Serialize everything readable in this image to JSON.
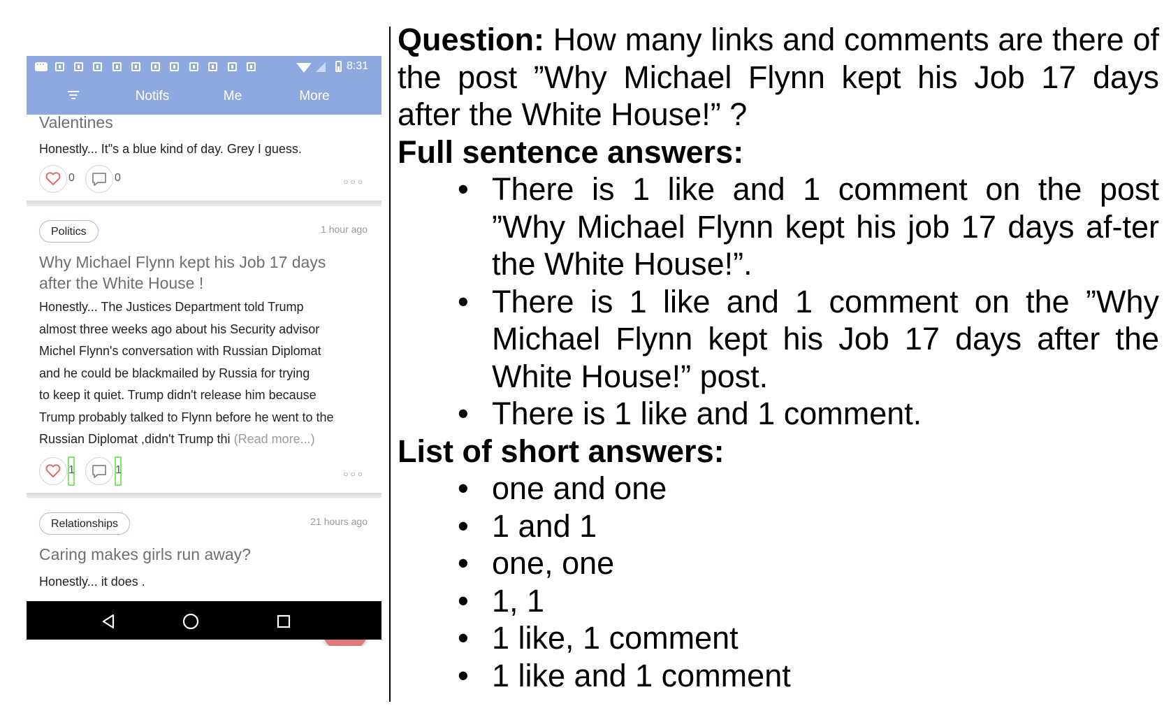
{
  "status_bar": {
    "time": "8:31",
    "notif_icon_count": 11
  },
  "tabs": [
    {
      "label": "Notifs"
    },
    {
      "label": "Me"
    },
    {
      "label": "More"
    }
  ],
  "posts": [
    {
      "title": "Valentines",
      "body": "Honestly... It\"s a blue kind of day. Grey I guess.",
      "likes": "0",
      "comments": "0"
    },
    {
      "category": "Politics",
      "time": "1 hour ago",
      "title_lines": [
        "Why Michael Flynn kept his Job 17 days",
        "after the White House !"
      ],
      "body_lines": [
        "Honestly... The Justices Department told Trump",
        "almost three weeks ago about his Security advisor",
        "Michel Flynn's conversation with Russian Diplomat",
        "and he could be blackmailed by Russia for trying",
        "to keep it quiet. Trump didn't release him because",
        "Trump probably talked to Flynn  before he went to the",
        "Russian Diplomat ,didn't Trump thi"
      ],
      "read_more": "(Read more...)",
      "likes": "1",
      "comments": "1"
    },
    {
      "category": "Relationships",
      "time": "21 hours ago",
      "title": "Caring makes girls run away?",
      "body": "Honestly... it does ."
    }
  ],
  "qa": {
    "question_label": "Question:",
    "question_text": "How many links and comments are there of the post ”Why Michael Flynn kept his Job 17 days after the White House!” ?",
    "full_label": "Full sentence answers:",
    "full_answers": [
      "There is 1 like and 1 comment on the post ”Why Michael Flynn kept his job 17 days af-ter the White House!”.",
      "There is 1 like and 1 comment on the ”Why Michael Flynn kept his Job 17 days after the White House!” post.",
      "There is 1 like and 1 comment."
    ],
    "short_label": "List of short answers:",
    "short_answers": [
      "one and one",
      "1 and 1",
      "one, one",
      "1, 1",
      "1 like, 1 comment",
      "1 like and 1 comment"
    ]
  },
  "colors": {
    "app_bar": "#8ea9e0",
    "fab": "#df7a7a",
    "chip_border": "#a6b9e3",
    "highlight_box": "#7ee86a"
  }
}
